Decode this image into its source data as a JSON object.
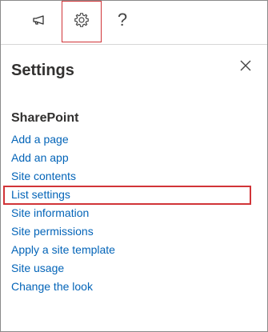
{
  "topbar": {
    "icons": [
      "megaphone-icon",
      "gear-icon",
      "help-icon"
    ],
    "help_label": "?"
  },
  "panel": {
    "title": "Settings",
    "close_icon": "close-icon"
  },
  "sharepoint": {
    "heading": "SharePoint",
    "links": [
      "Add a page",
      "Add an app",
      "Site contents",
      "List settings",
      "Site information",
      "Site permissions",
      "Apply a site template",
      "Site usage",
      "Change the look"
    ],
    "highlighted_index": 3
  },
  "colors": {
    "link": "#0364b8",
    "highlight": "#d13438",
    "text": "#323130"
  }
}
